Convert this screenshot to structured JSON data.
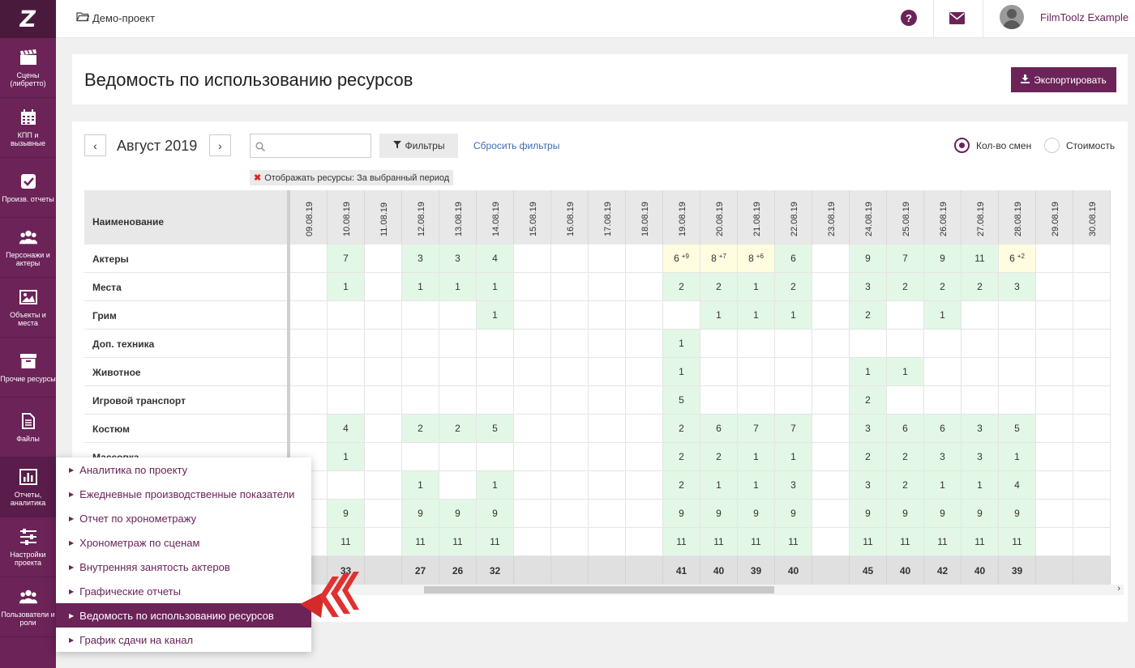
{
  "sidebar": {
    "logo": "Z",
    "items": [
      {
        "label": "Сцены (либретто)",
        "icon": "clapperboard-icon"
      },
      {
        "label": "КПП и вызывные",
        "icon": "calendar-icon"
      },
      {
        "label": "Произв. отчеты",
        "icon": "checkbox-icon"
      },
      {
        "label": "Персонажи и актеры",
        "icon": "users-icon"
      },
      {
        "label": "Объекты и места",
        "icon": "image-icon"
      },
      {
        "label": "Прочие ресурсы",
        "icon": "archive-icon"
      },
      {
        "label": "Файлы",
        "icon": "file-icon"
      },
      {
        "label": "Отчеты, аналитика",
        "icon": "bar-chart-icon"
      },
      {
        "label": "Настройки проекта",
        "icon": "sliders-icon"
      },
      {
        "label": "Пользователи и роли",
        "icon": "users-icon"
      }
    ]
  },
  "topbar": {
    "breadcrumb": "Демо-проект",
    "help": "?",
    "user": "FilmToolz Example"
  },
  "header": {
    "title": "Ведомость по использованию ресурсов",
    "export_label": "Экспортировать"
  },
  "toolbar": {
    "prev": "‹",
    "next": "›",
    "month": "Август 2019",
    "search_placeholder": "",
    "filters_label": "Фильтры",
    "reset_label": "Сбросить фильтры",
    "radio_shifts": "Кол-во смен",
    "radio_cost": "Стоимость",
    "selected_radio": "shifts",
    "filter_tag": "Отображать ресурсы:  За выбранный период"
  },
  "table": {
    "name_header": "Наименование",
    "dates": [
      "09.08.19",
      "10.08.19",
      "11.08.19",
      "12.08.19",
      "13.08.19",
      "14.08.19",
      "15.08.19",
      "16.08.19",
      "17.08.19",
      "18.08.19",
      "19.08.19",
      "20.08.19",
      "21.08.19",
      "22.08.19",
      "23.08.19",
      "24.08.19",
      "25.08.19",
      "26.08.19",
      "27.08.19",
      "28.08.19",
      "29.08.19",
      "30.08.19"
    ],
    "rows": [
      {
        "name": "Актеры",
        "cells": [
          "",
          "7",
          "",
          "3",
          "3",
          "4",
          "",
          "",
          "",
          "",
          "6|+9",
          "8|+7",
          "8|+6",
          "6",
          "",
          "9",
          "7",
          "9",
          "11",
          "6|+2",
          "",
          ""
        ]
      },
      {
        "name": "Места",
        "cells": [
          "",
          "1",
          "",
          "1",
          "1",
          "1",
          "",
          "",
          "",
          "",
          "2",
          "2",
          "1",
          "2",
          "",
          "3",
          "2",
          "2",
          "2",
          "3",
          "",
          ""
        ]
      },
      {
        "name": "Грим",
        "cells": [
          "",
          "",
          "",
          "",
          "",
          "1",
          "",
          "",
          "",
          "",
          "",
          "1",
          "1",
          "1",
          "",
          "2",
          "",
          "1",
          "",
          "",
          "",
          ""
        ]
      },
      {
        "name": "Доп. техника",
        "cells": [
          "",
          "",
          "",
          "",
          "",
          "",
          "",
          "",
          "",
          "",
          "1",
          "",
          "",
          "",
          "",
          "",
          "",
          "",
          "",
          "",
          "",
          ""
        ]
      },
      {
        "name": "Животное",
        "cells": [
          "",
          "",
          "",
          "",
          "",
          "",
          "",
          "",
          "",
          "",
          "1",
          "",
          "",
          "",
          "",
          "1",
          "1",
          "",
          "",
          "",
          "",
          ""
        ]
      },
      {
        "name": "Игровой транспорт",
        "cells": [
          "",
          "",
          "",
          "",
          "",
          "",
          "",
          "",
          "",
          "",
          "5",
          "",
          "",
          "",
          "",
          "2",
          "",
          "",
          "",
          "",
          "",
          ""
        ]
      },
      {
        "name": "Костюм",
        "cells": [
          "",
          "4",
          "",
          "2",
          "2",
          "5",
          "",
          "",
          "",
          "",
          "2",
          "6",
          "7",
          "7",
          "",
          "3",
          "6",
          "6",
          "3",
          "5",
          "",
          ""
        ]
      },
      {
        "name": "Массовка",
        "cells": [
          "",
          "1",
          "",
          "",
          "",
          "",
          "",
          "",
          "",
          "",
          "2",
          "2",
          "1",
          "1",
          "",
          "2",
          "2",
          "3",
          "3",
          "1",
          "",
          ""
        ]
      },
      {
        "name": "",
        "cells": [
          "",
          "",
          "",
          "1",
          "",
          "1",
          "",
          "",
          "",
          "",
          "2",
          "1",
          "1",
          "3",
          "",
          "3",
          "2",
          "1",
          "1",
          "4",
          "",
          ""
        ]
      },
      {
        "name": "",
        "cells": [
          "",
          "9",
          "",
          "9",
          "9",
          "9",
          "",
          "",
          "",
          "",
          "9",
          "9",
          "9",
          "9",
          "",
          "9",
          "9",
          "9",
          "9",
          "9",
          "",
          ""
        ]
      },
      {
        "name": "",
        "cells": [
          "",
          "11",
          "",
          "11",
          "11",
          "11",
          "",
          "",
          "",
          "",
          "11",
          "11",
          "11",
          "11",
          "",
          "11",
          "11",
          "11",
          "11",
          "11",
          "",
          ""
        ]
      }
    ],
    "totals": [
      "",
      "33",
      "",
      "27",
      "26",
      "32",
      "",
      "",
      "",
      "",
      "41",
      "40",
      "39",
      "40",
      "",
      "45",
      "40",
      "42",
      "40",
      "39",
      "",
      ""
    ]
  },
  "popup_menu": {
    "items": [
      "Аналитика по проекту",
      "Ежедневные производственные показатели",
      "Отчет по хронометражу",
      "Хронометраж по сценам",
      "Внутренняя занятость актеров",
      "Графические отчеты",
      "Ведомость по использованию ресурсов",
      "График сдачи на канал"
    ],
    "active_index": 6
  },
  "colors": {
    "brand": "#6b2358",
    "cell_green": "#e3f7e6",
    "cell_yellow": "#fffce0",
    "link": "#3b6cb5",
    "arrow_red": "#e03030"
  }
}
